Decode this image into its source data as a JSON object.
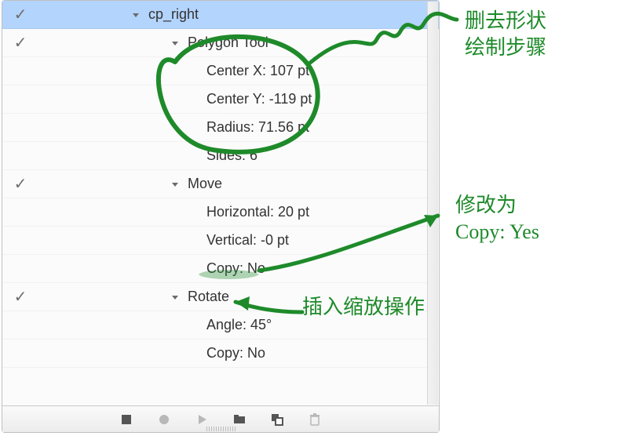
{
  "rows": [
    {
      "checked": true,
      "indent": 1,
      "chev": true,
      "label": "cp_right",
      "selected": true
    },
    {
      "checked": true,
      "indent": 2,
      "chev": true,
      "label": "Polygon Tool"
    },
    {
      "checked": false,
      "indent": 3,
      "chev": false,
      "label": "Center X: 107 pt"
    },
    {
      "checked": false,
      "indent": 3,
      "chev": false,
      "label": "Center Y: -119 pt"
    },
    {
      "checked": false,
      "indent": 3,
      "chev": false,
      "label": "Radius: 71.56 pt"
    },
    {
      "checked": false,
      "indent": 3,
      "chev": false,
      "label": "Sides: 6"
    },
    {
      "checked": true,
      "indent": 2,
      "chev": true,
      "label": "Move"
    },
    {
      "checked": false,
      "indent": 3,
      "chev": false,
      "label": "Horizontal: 20 pt"
    },
    {
      "checked": false,
      "indent": 3,
      "chev": false,
      "label": "Vertical: -0 pt"
    },
    {
      "checked": false,
      "indent": 3,
      "chev": false,
      "label": "Copy: No"
    },
    {
      "checked": true,
      "indent": 2,
      "chev": true,
      "label": "Rotate"
    },
    {
      "checked": false,
      "indent": 3,
      "chev": false,
      "label": "Angle: 45°"
    },
    {
      "checked": false,
      "indent": 3,
      "chev": false,
      "label": "Copy: No"
    }
  ],
  "annotations": {
    "a1_l1": "删去形状",
    "a1_l2": "绘制步骤",
    "a2_l1": "修改为",
    "a2_l2": "Copy: Yes",
    "a3": "插入缩放操作"
  },
  "toolbar": {
    "stop": "stop",
    "record": "record",
    "play": "play",
    "folder": "folder",
    "overlay": "overlay",
    "trash": "trash"
  }
}
